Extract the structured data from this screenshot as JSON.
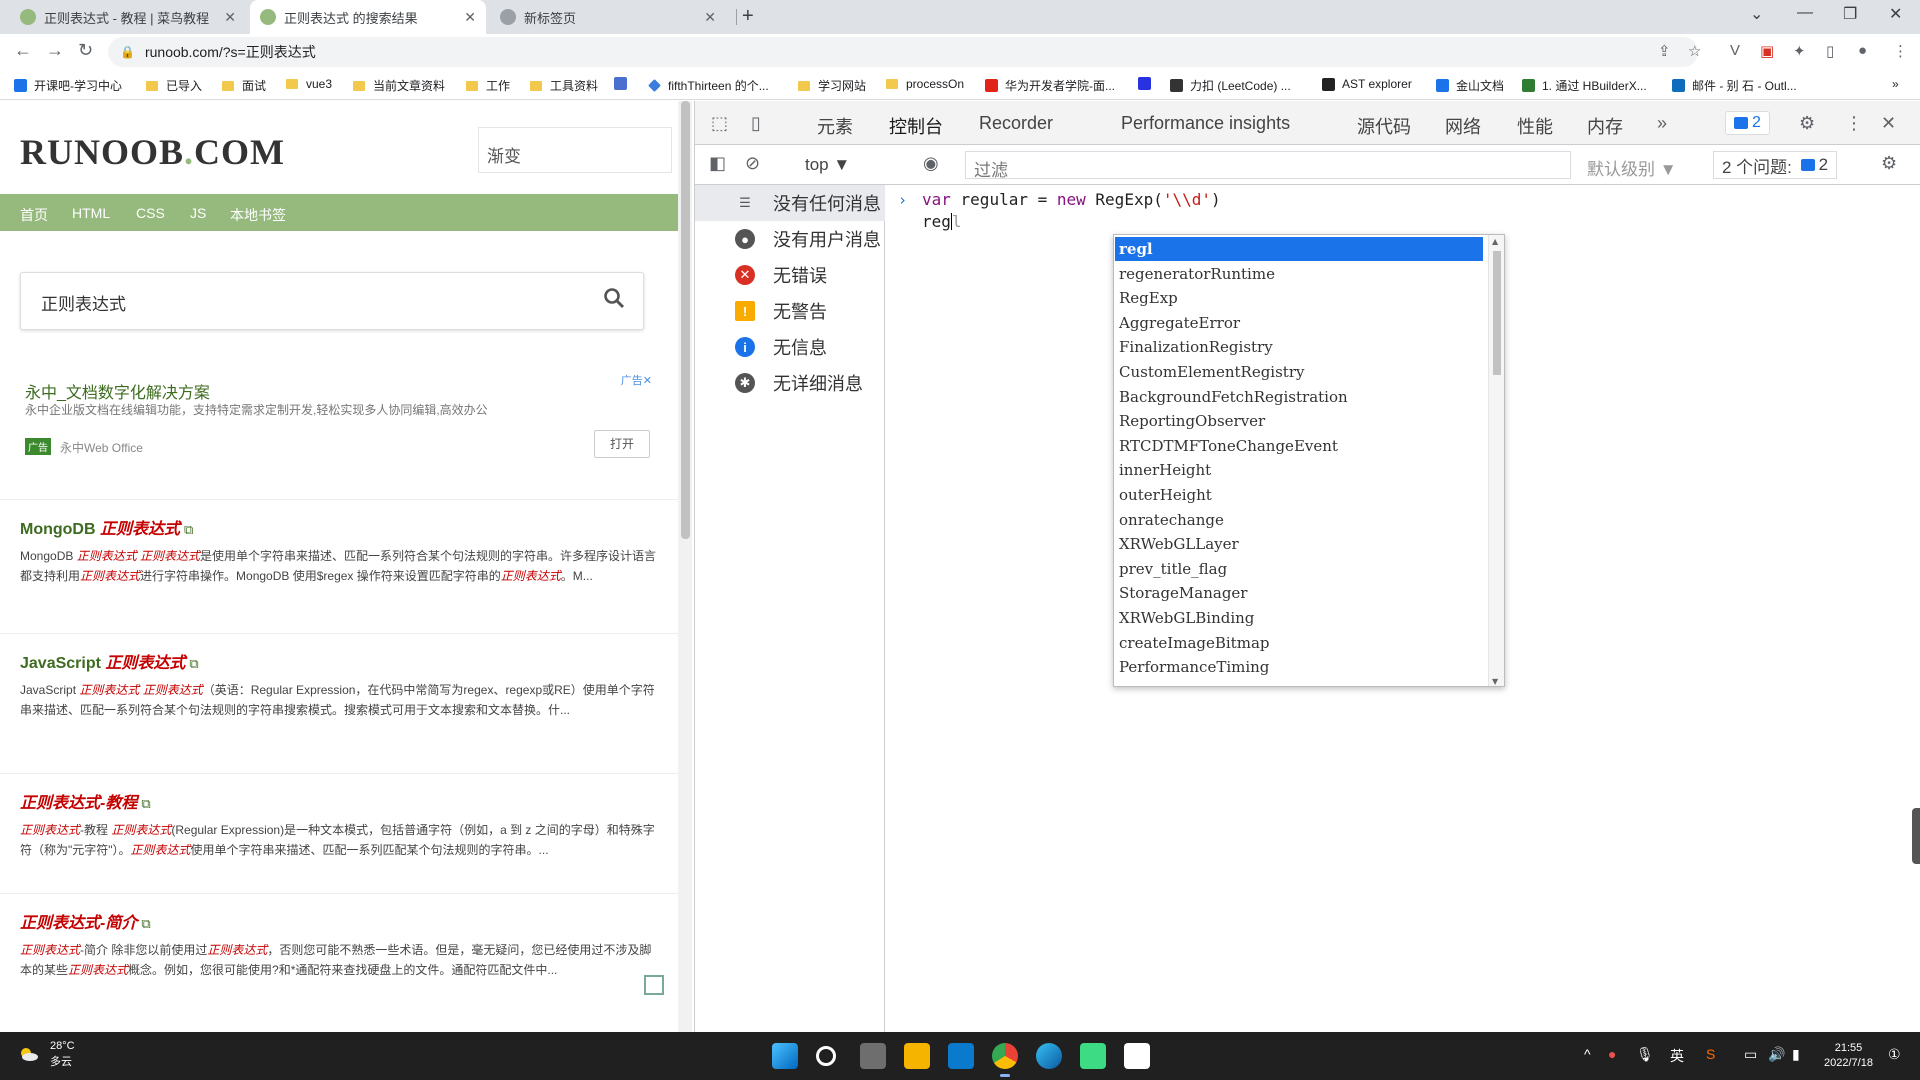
{
  "browser": {
    "tabs": [
      {
        "title": "正则表达式 - 教程 | 菜鸟教程"
      },
      {
        "title": "正则表达式 的搜索结果"
      },
      {
        "title": "新标签页"
      }
    ],
    "url": "runoob.com/?s=正则表达式",
    "bookmarks": [
      "开课吧-学习中心",
      "已导入",
      "面试",
      "vue3",
      "当前文章资料",
      "工作",
      "工具资料",
      "fifthThirteen 的个...",
      "学习网站",
      "processOn",
      "华为开发者学院-面...",
      "力扣 (LeetCode) ...",
      "AST explorer",
      "金山文档",
      "1. 通过 HBuilderX...",
      "邮件 - 别 石 - Outl..."
    ]
  },
  "site": {
    "logo_main": "RUNOOB",
    "logo_dot": ".",
    "logo_tld": "COM",
    "search_placeholder": "渐变",
    "nav": [
      "首页",
      "HTML",
      "CSS",
      "JS",
      "本地书签"
    ],
    "query": "正则表达式",
    "ad": {
      "title": "永中_文档数字化解决方案",
      "desc": "永中企业版文档在线编辑功能，支持特定需求定制开发,轻松实现多人协同编辑,高效办公",
      "badge": "广告✕",
      "tag": "广告",
      "brand": "永中Web Office",
      "button": "打开"
    },
    "results": [
      {
        "prefix": "MongoDB ",
        "em": "正则表达式",
        "desc_parts": [
          "MongoDB ",
          "正则表达式 正则表达式",
          "是使用单个字符串来描述、匹配一系列符合某个句法规则的字符串。许多程序设计语言都支持利用",
          "正则表达式",
          "进行字符串操作。MongoDB 使用$regex 操作符来设置匹配字符串的",
          "正则表达式",
          "。M..."
        ]
      },
      {
        "prefix": "JavaScript ",
        "em": "正则表达式",
        "desc_parts": [
          "JavaScript ",
          "正则表达式 正则表达式",
          "（英语：Regular Expression，在代码中常简写为regex、regexp或RE）使用单个字符串来描述、匹配一系列符合某个句法规则的字符串搜索模式。搜索模式可用于文本搜索和文本替换。什...",
          "",
          "",
          "",
          ""
        ]
      },
      {
        "prefix": "",
        "em": "正则表达式-教程",
        "desc_parts": [
          "",
          "正则表达式",
          "-教程 ",
          "正则表达式",
          "(Regular Expression)是一种文本模式，包括普通字符（例如，a 到 z 之间的字母）和特殊字符（称为\"元字符\"）。",
          "正则表达式",
          "使用单个字符串来描述、匹配一系列匹配某个句法规则的字符串。..."
        ]
      },
      {
        "prefix": "",
        "em": "正则表达式-简介",
        "desc_parts": [
          "",
          "正则表达式",
          "-简介 除非您以前使用过",
          "正则表达式",
          "，否则您可能不熟悉一些术语。但是，毫无疑问，您已经使用过不涉及脚本的某些",
          "正则表达式",
          "概念。例如，您很可能使用?和*通配符来查找硬盘上的文件。通配符匹配文件中..."
        ]
      }
    ]
  },
  "devtools": {
    "tabs": [
      "元素",
      "控制台",
      "Recorder",
      "Performance insights",
      "源代码",
      "网络",
      "性能",
      "内存"
    ],
    "active_tab": "控制台",
    "issues_badge": "2",
    "context": "top ▼",
    "filter_placeholder": "过滤",
    "level": "默认级别 ▼",
    "issues_label": "2 个问题:",
    "issues_count": "2",
    "sidebar": [
      "没有任何消息",
      "没有用户消息",
      "无错误",
      "无警告",
      "无信息",
      "无详细消息"
    ],
    "console_line1_a": "var",
    "console_line1_b": " regular = ",
    "console_line1_c": "new",
    "console_line1_d": " RegExp(",
    "console_line1_e": "'\\\\d'",
    "console_line1_f": ")",
    "console_typed": "reg",
    "console_ghost": "l",
    "autocomplete": [
      "regl",
      "regeneratorRuntime",
      "RegExp",
      "AggregateError",
      "FinalizationRegistry",
      "CustomElementRegistry",
      "BackgroundFetchRegistration",
      "ReportingObserver",
      "RTCDTMFToneChangeEvent",
      "innerHeight",
      "outerHeight",
      "onratechange",
      "XRWebGLLayer",
      "prev_title_flag",
      "StorageManager",
      "XRWebGLBinding",
      "createImageBitmap",
      "PerformanceTiming"
    ]
  },
  "taskbar": {
    "temp": "28°C",
    "weather": "多云",
    "tray_lang": "英",
    "time": "21:55",
    "date": "2022/7/18"
  }
}
